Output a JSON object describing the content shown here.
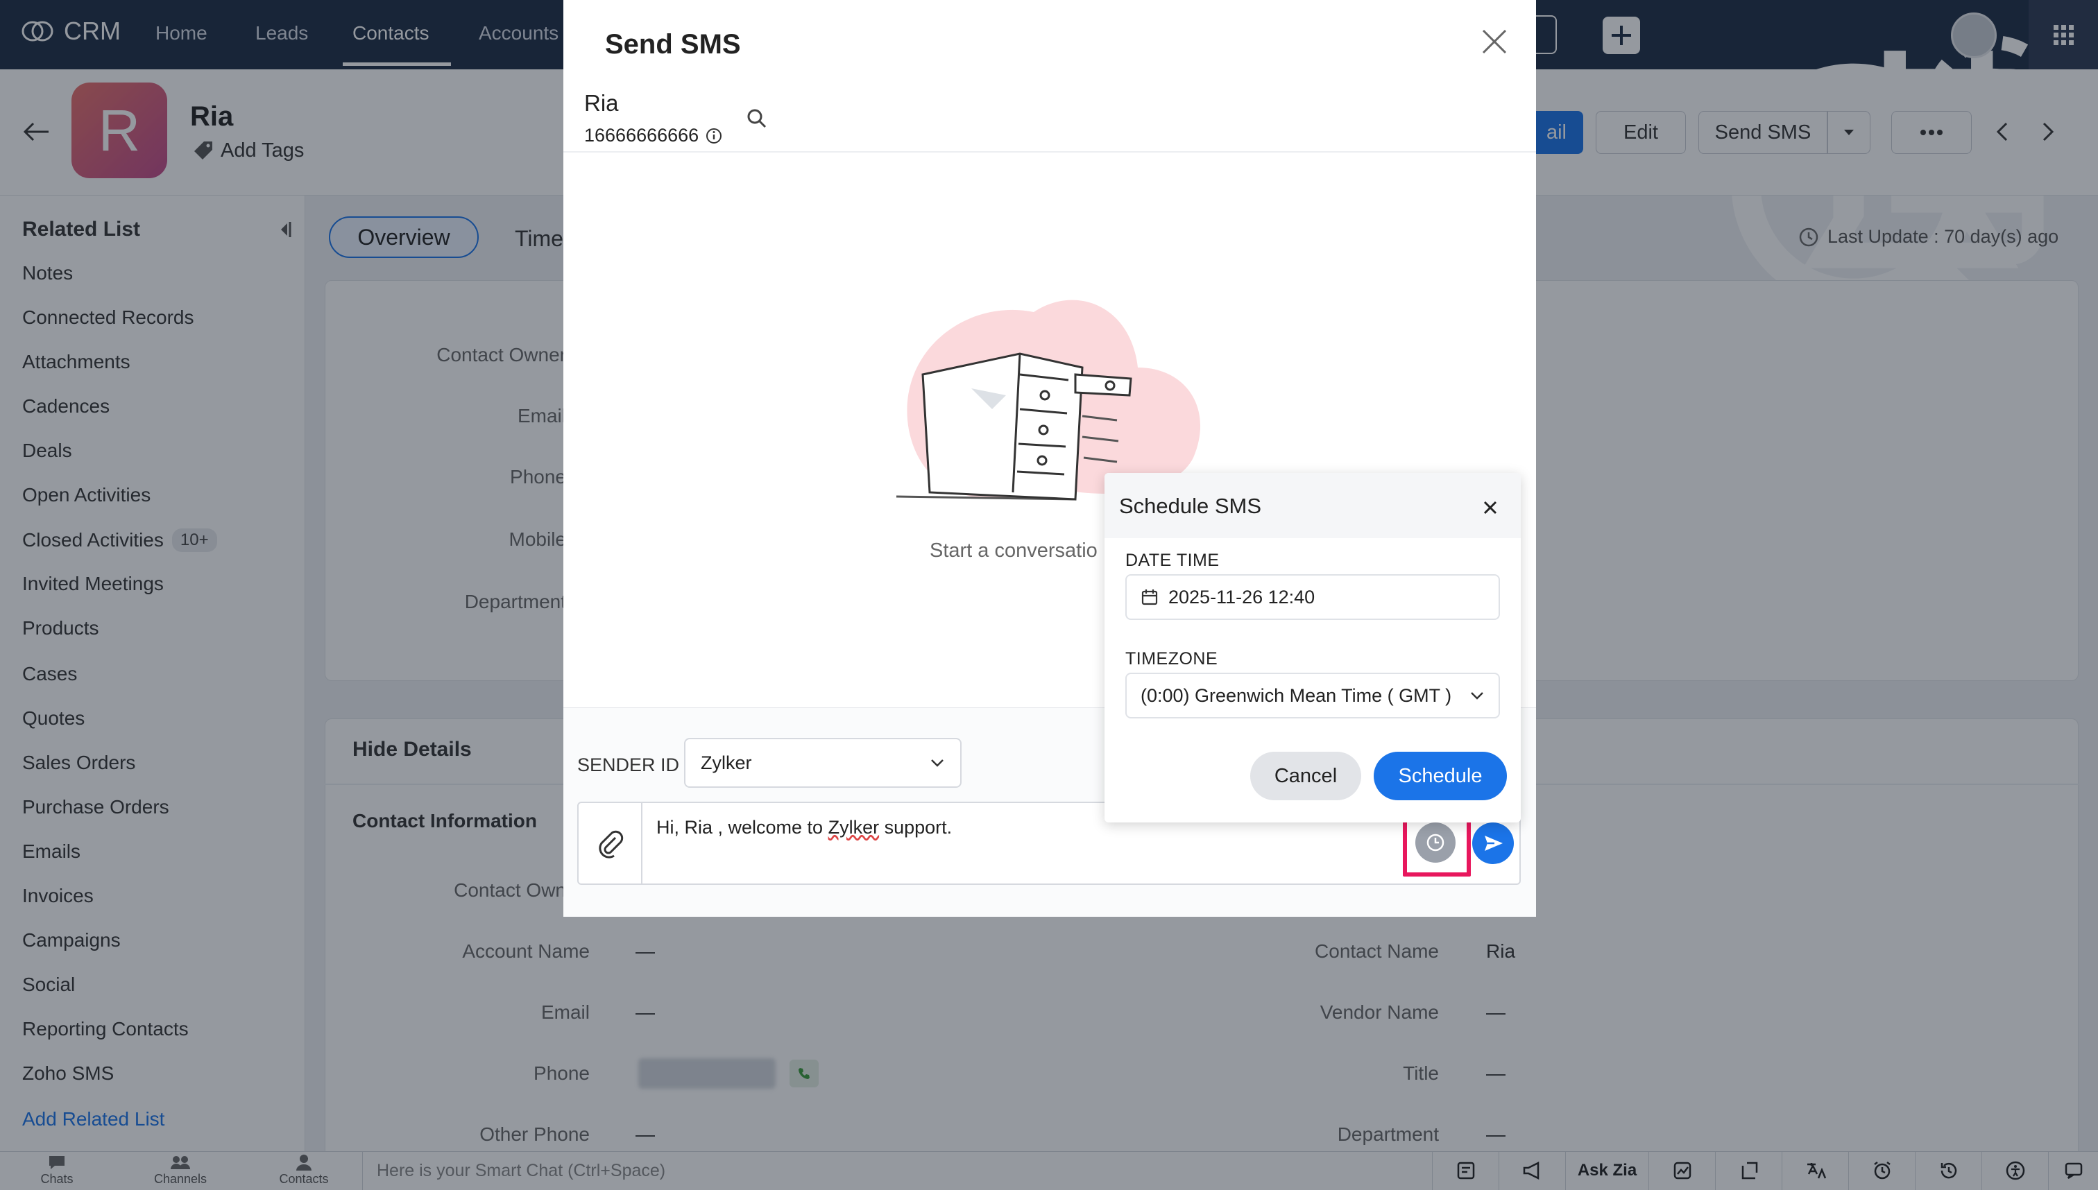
{
  "app": {
    "name": "CRM"
  },
  "topnav": {
    "items": [
      {
        "label": "Home"
      },
      {
        "label": "Leads"
      },
      {
        "label": "Contacts"
      },
      {
        "label": "Accounts"
      }
    ]
  },
  "record": {
    "avatar_letter": "R",
    "name": "Ria",
    "add_tags": "Add Tags",
    "buttons": {
      "blue_partial": "ail",
      "edit": "Edit",
      "send_sms": "Send SMS"
    }
  },
  "sidebar": {
    "title": "Related List",
    "items": [
      {
        "label": "Notes"
      },
      {
        "label": "Connected Records"
      },
      {
        "label": "Attachments"
      },
      {
        "label": "Cadences"
      },
      {
        "label": "Deals"
      },
      {
        "label": "Open Activities"
      },
      {
        "label": "Closed Activities",
        "badge": "10+"
      },
      {
        "label": "Invited Meetings"
      },
      {
        "label": "Products"
      },
      {
        "label": "Cases"
      },
      {
        "label": "Quotes"
      },
      {
        "label": "Sales Orders"
      },
      {
        "label": "Purchase Orders"
      },
      {
        "label": "Emails"
      },
      {
        "label": "Invoices"
      },
      {
        "label": "Campaigns"
      },
      {
        "label": "Social"
      },
      {
        "label": "Reporting Contacts"
      },
      {
        "label": "Zoho SMS"
      }
    ],
    "add_link": "Add Related List"
  },
  "main": {
    "tabs": [
      {
        "label": "Overview"
      },
      {
        "label": "Time"
      }
    ],
    "last_update": "Last Update : 70 day(s) ago",
    "overview_labels": [
      "Contact Owner",
      "Email",
      "Phone",
      "Mobile",
      "Department"
    ],
    "hide_details": "Hide Details",
    "contact_info": "Contact Information",
    "left_fields": [
      {
        "label": "Contact Own",
        "value": ""
      },
      {
        "label": "Account Name",
        "value": "—"
      },
      {
        "label": "Email",
        "value": "—"
      },
      {
        "label": "Phone",
        "value": ""
      },
      {
        "label": "Other Phone",
        "value": "—"
      }
    ],
    "right_fields": [
      {
        "label": "Contact Name",
        "value": "Ria"
      },
      {
        "label": "Vendor Name",
        "value": "—"
      },
      {
        "label": "Title",
        "value": "—"
      },
      {
        "label": "Department",
        "value": "—"
      }
    ]
  },
  "bottombar": {
    "tabs": [
      {
        "label": "Chats"
      },
      {
        "label": "Channels"
      },
      {
        "label": "Contacts"
      }
    ],
    "chat_placeholder": "Here is your Smart Chat (Ctrl+Space)",
    "ask_zia": "Ask Zia"
  },
  "sms_modal": {
    "title": "Send SMS",
    "contact_name": "Ria",
    "contact_phone": "16666666666",
    "empty_text": "Start a conversatio",
    "sender_label": "SENDER ID",
    "sender_value": "Zylker",
    "message_before": "Hi, Ria , welcome to ",
    "message_word": "Zylker",
    "message_after": " support."
  },
  "schedule": {
    "title": "Schedule SMS",
    "datetime_label": "DATE TIME",
    "datetime_value": "2025-11-26 12:40",
    "timezone_label": "TIMEZONE",
    "timezone_value": "(0:00) Greenwich Mean Time ( GMT )",
    "cancel": "Cancel",
    "schedule": "Schedule"
  },
  "colors": {
    "accent": "#1b74e8",
    "navbar": "#1d2c44",
    "highlight": "#e8175d"
  }
}
